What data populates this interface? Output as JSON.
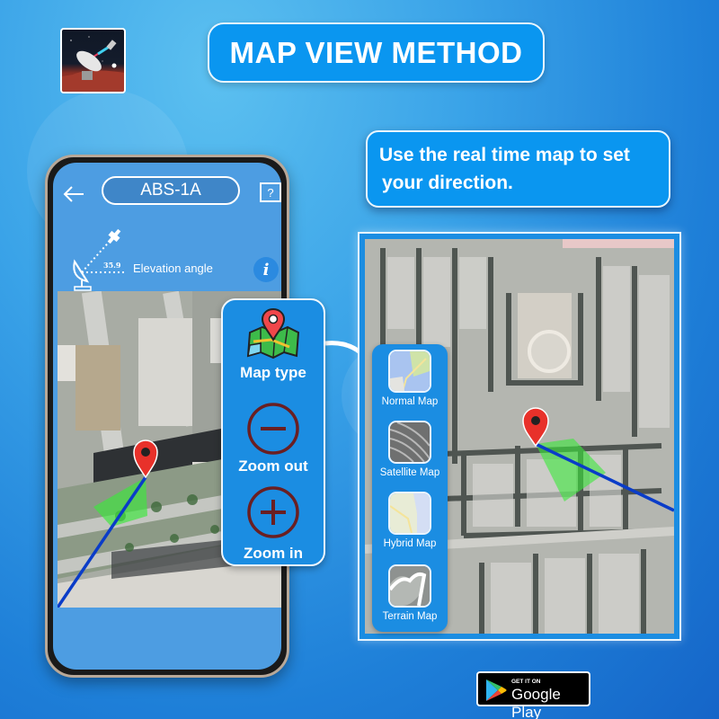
{
  "header": {
    "title": "MAP VIEW METHOD",
    "app_icon": "satellite-dish-app-icon"
  },
  "callout": {
    "line1": "Use the real time map to set",
    "line2": "your direction."
  },
  "phone": {
    "back_icon": "arrow-left-icon",
    "satellite_name": "ABS-1A",
    "help_label": "?",
    "elevation_value": "35.9",
    "elevation_label": "Elevation angle",
    "info_label": "i"
  },
  "controls": {
    "map_type_label": "Map type",
    "zoom_out_label": "Zoom out",
    "zoom_in_label": "Zoom in"
  },
  "map_types": [
    {
      "label": "Normal Map",
      "icon": "normal-map-thumb"
    },
    {
      "label": "Satellite Map",
      "icon": "satellite-map-thumb"
    },
    {
      "label": "Hybrid Map",
      "icon": "hybrid-map-thumb"
    },
    {
      "label": "Terrain Map",
      "icon": "terrain-map-thumb"
    }
  ],
  "store_badge": {
    "small": "GET IT ON",
    "big": "Google Play"
  },
  "colors": {
    "accent": "#0a96f0",
    "panel": "#1b8de2",
    "phone_screen": "#4d9de2",
    "pin": "#e8312a",
    "beam": "#3ad43a",
    "direction_line": "#0a3cc8"
  }
}
